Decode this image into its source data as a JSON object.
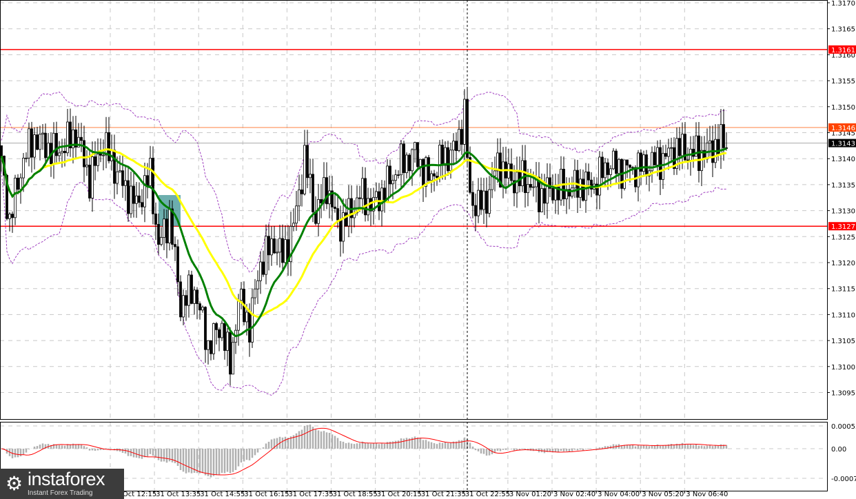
{
  "chart_data": {
    "type": "candlestick",
    "symbol_timeframe": "M5",
    "price_axis": {
      "min": 1.3092,
      "max": 1.317,
      "ticks": [
        "1.3170",
        "1.3165",
        "1.3160",
        "1.3155",
        "1.3150",
        "1.3145",
        "1.3140",
        "1.3135",
        "1.3130",
        "1.3125",
        "1.3120",
        "1.3115",
        "1.3110",
        "1.3105",
        "1.3100",
        "1.3095"
      ]
    },
    "macd_axis": {
      "ticks": [
        "0.00055",
        "0.00",
        "-0.00073"
      ],
      "max": 0.00055,
      "min": -0.00073
    },
    "time_labels": [
      "31 Oct 12:15",
      "31 Oct 13:35",
      "31 Oct 14:55",
      "31 Oct 16:15",
      "31 Oct 17:35",
      "31 Oct 18:55",
      "31 Oct 20:15",
      "31 Oct 21:35",
      "31 Oct 22:55",
      "3 Nov 01:20",
      "3 Nov 02:40",
      "3 Nov 04:00",
      "3 Nov 05:20",
      "3 Nov 06:40"
    ],
    "price_path_anchors": [
      [
        0,
        1.3139
      ],
      [
        3,
        1.3128
      ],
      [
        8,
        1.314
      ],
      [
        12,
        1.3144
      ],
      [
        20,
        1.3141
      ],
      [
        27,
        1.3145
      ],
      [
        32,
        1.3136
      ],
      [
        37,
        1.3143
      ],
      [
        44,
        1.3135
      ],
      [
        49,
        1.3131
      ],
      [
        54,
        1.3137
      ],
      [
        57,
        1.3123
      ],
      [
        61,
        1.3129
      ],
      [
        65,
        1.3112
      ],
      [
        70,
        1.3115
      ],
      [
        75,
        1.3104
      ],
      [
        80,
        1.3108
      ],
      [
        83,
        1.31
      ],
      [
        86,
        1.3113
      ],
      [
        90,
        1.3108
      ],
      [
        94,
        1.312
      ],
      [
        99,
        1.3124
      ],
      [
        102,
        1.3121
      ],
      [
        106,
        1.3127
      ],
      [
        110,
        1.314
      ],
      [
        114,
        1.3129
      ],
      [
        118,
        1.3135
      ],
      [
        122,
        1.3127
      ],
      [
        126,
        1.3129
      ],
      [
        130,
        1.3133
      ],
      [
        135,
        1.3131
      ],
      [
        140,
        1.3135
      ],
      [
        145,
        1.3139
      ],
      [
        150,
        1.3141
      ],
      [
        155,
        1.3136
      ],
      [
        160,
        1.314
      ],
      [
        165,
        1.3142
      ],
      [
        168,
        1.3149
      ],
      [
        170,
        1.3132
      ],
      [
        175,
        1.3131
      ],
      [
        180,
        1.3139
      ],
      [
        185,
        1.3136
      ],
      [
        190,
        1.3136
      ],
      [
        195,
        1.3133
      ],
      [
        200,
        1.3134
      ],
      [
        205,
        1.3134
      ],
      [
        210,
        1.3135
      ],
      [
        215,
        1.3135
      ],
      [
        220,
        1.3139
      ],
      [
        225,
        1.3138
      ],
      [
        230,
        1.3138
      ],
      [
        235,
        1.3139
      ],
      [
        240,
        1.314
      ],
      [
        245,
        1.3142
      ],
      [
        250,
        1.3141
      ],
      [
        255,
        1.3141
      ],
      [
        260,
        1.3143
      ],
      [
        263,
        1.3143
      ]
    ],
    "levels": [
      {
        "label": "1.3161",
        "price": 1.3161,
        "color": "#ff0000"
      },
      {
        "label": "1.3127",
        "price": 1.3127,
        "color": "#ff0000"
      },
      {
        "label": "1.3146",
        "price": 1.3146,
        "color": "#ff4400"
      },
      {
        "label": "1.3143",
        "price": 1.3143,
        "color": "#000000"
      }
    ],
    "signal_box": {
      "from_index": 57,
      "to_index": 65,
      "price_high": 1.3133,
      "price_low": 1.3127,
      "color": "#2e8b8b"
    },
    "session_divider_index": 169,
    "indicators": [
      {
        "name": "MA fast",
        "color": "#008000",
        "period": 14
      },
      {
        "name": "MA slow",
        "color": "#ffff00",
        "period": 30
      },
      {
        "name": "Bollinger Bands",
        "color": "#a040c0",
        "period": 20
      },
      {
        "name": "MACD",
        "histogram_color": "#b0b0b0",
        "signal_color": "#ff0000"
      }
    ]
  },
  "branding": {
    "name": "instaforex",
    "tagline": "Instant Forex Trading"
  }
}
